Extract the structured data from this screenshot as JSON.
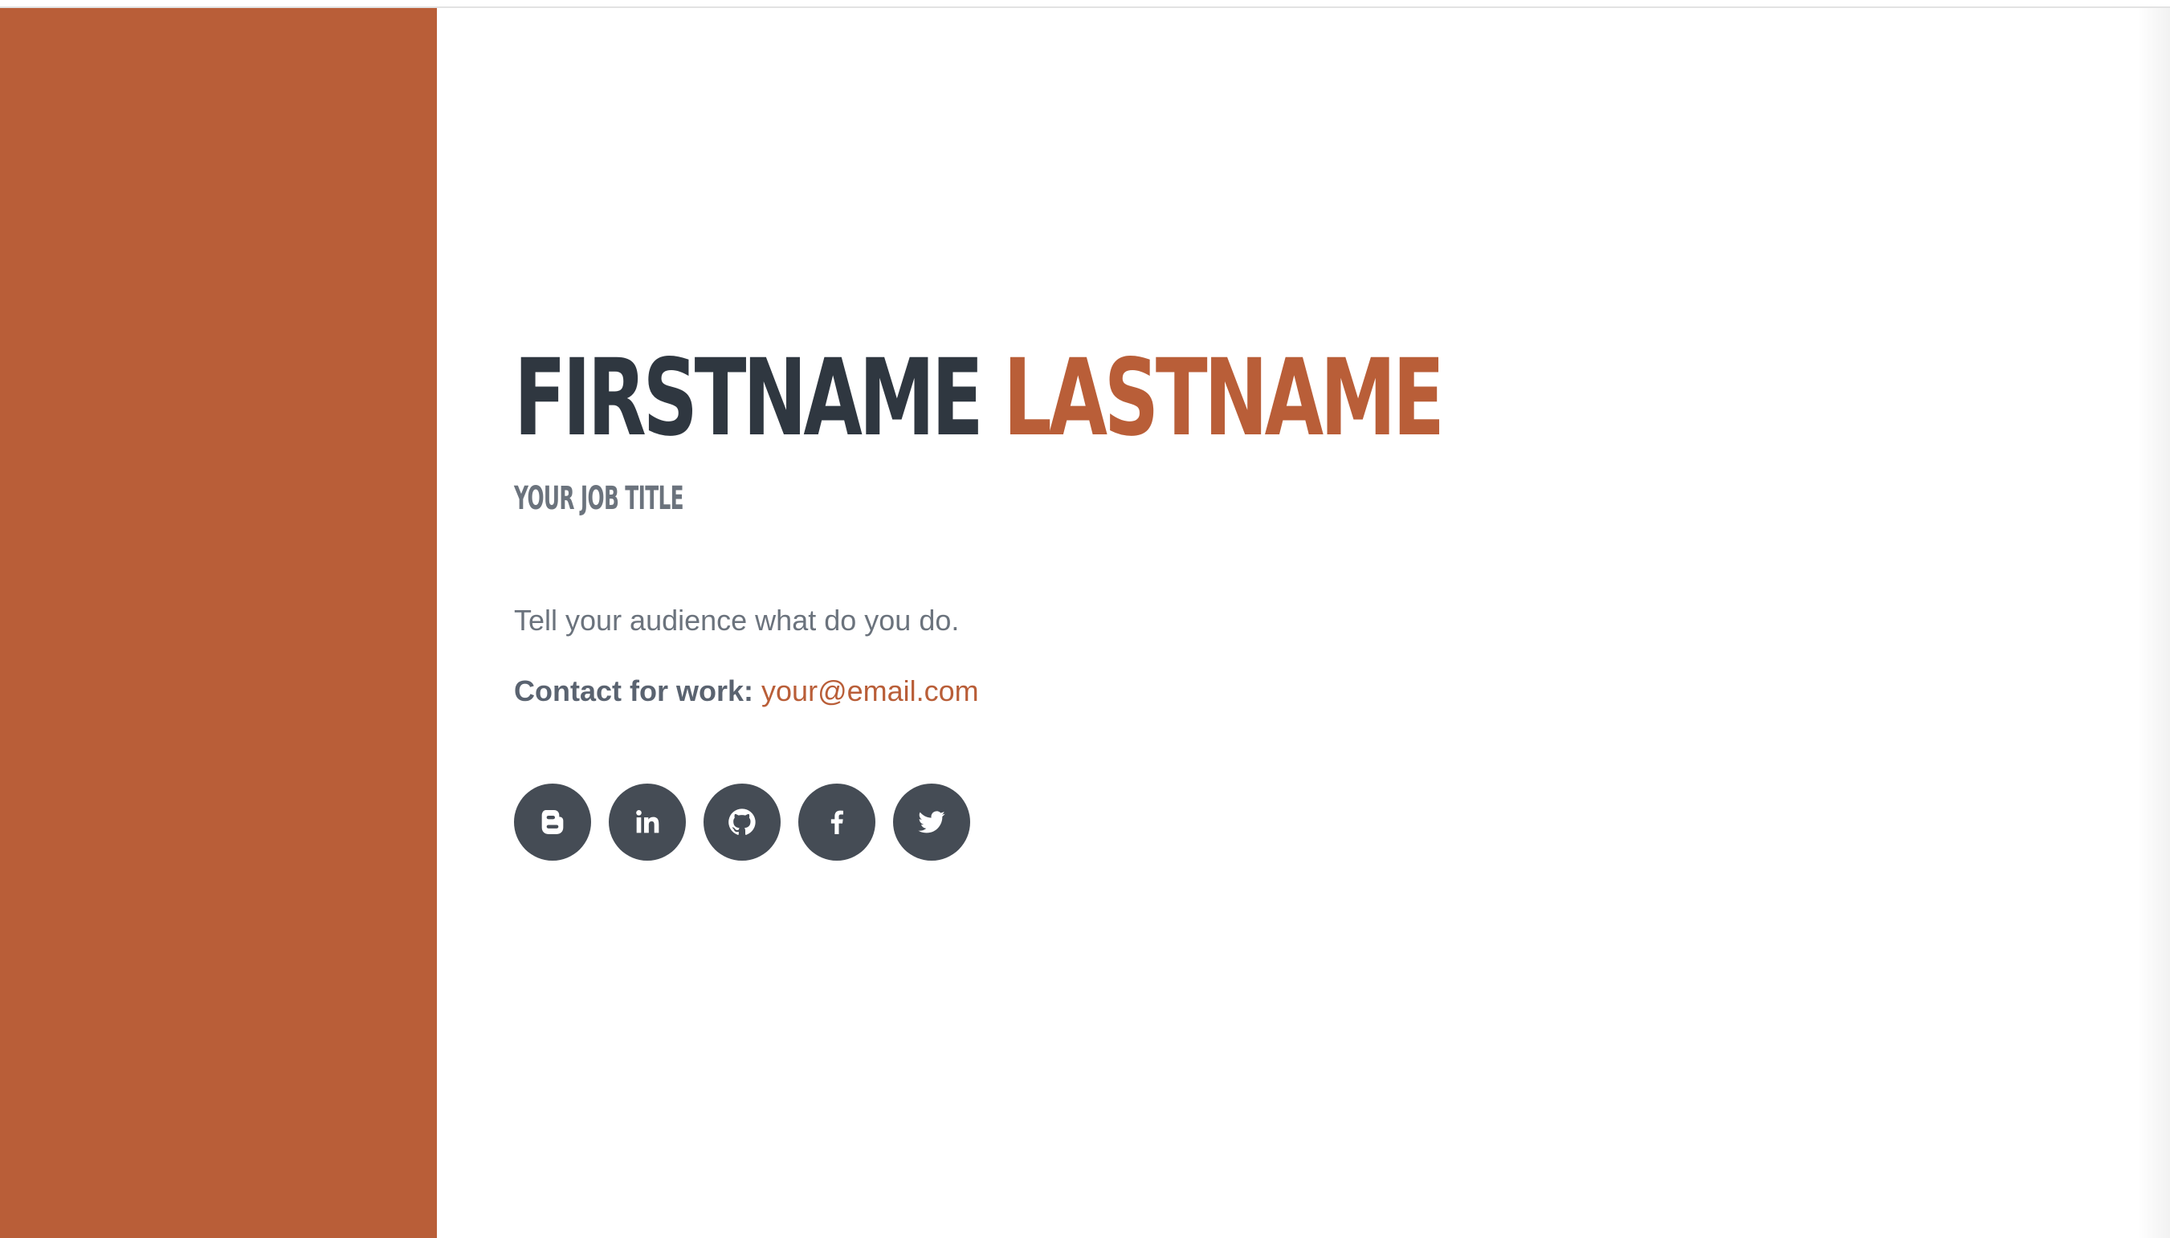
{
  "profile": {
    "first_name": "FIRSTNAME",
    "last_name": "LASTNAME",
    "job_title": "YOUR JOB TITLE",
    "tagline": "Tell your audience what do you do.",
    "contact_label": "Contact for work:",
    "email": "your@email.com"
  },
  "social_links": [
    {
      "icon": "blogger-icon"
    },
    {
      "icon": "linkedin-icon"
    },
    {
      "icon": "github-icon"
    },
    {
      "icon": "facebook-icon"
    },
    {
      "icon": "twitter-icon"
    }
  ],
  "colors": {
    "accent": "#b95e38",
    "heading_dark": "#2f3740",
    "muted_text": "#6b737d",
    "icon_bg": "#454c55"
  }
}
